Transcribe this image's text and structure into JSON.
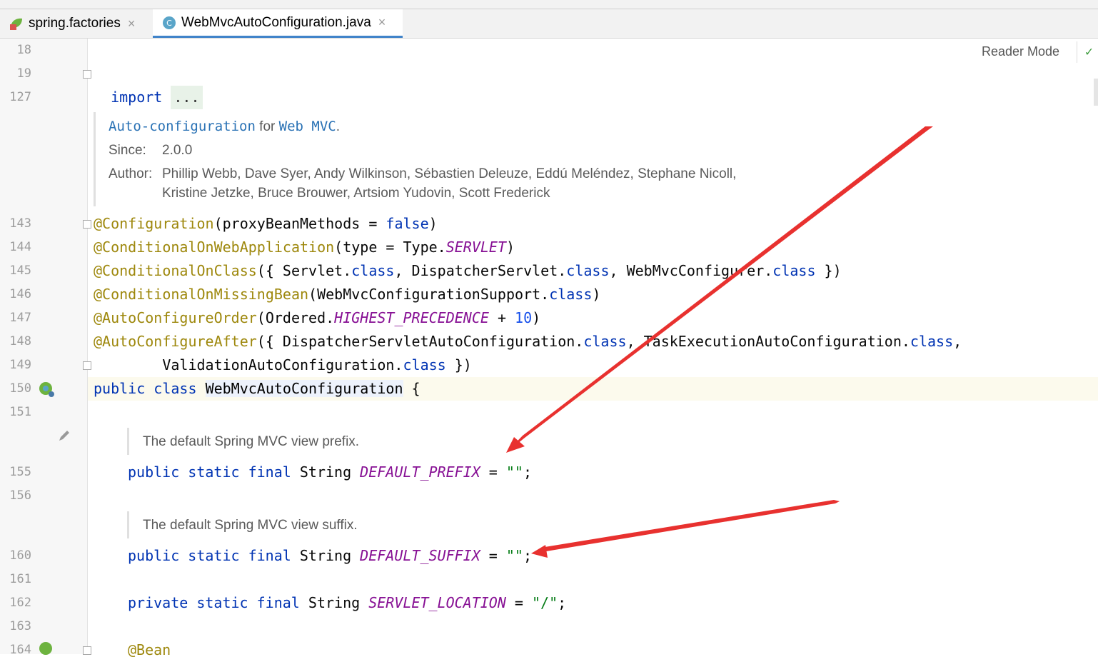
{
  "tabs": [
    {
      "label": "spring.factories",
      "icon": "spring-factories-icon",
      "close": "×"
    },
    {
      "label": "WebMvcAutoConfiguration.java",
      "icon": "java-class-icon",
      "close": "×"
    }
  ],
  "toolbar": {
    "reader_mode": "Reader Mode",
    "check": "✓"
  },
  "line_numbers": [
    "18",
    "19",
    "127",
    "143",
    "144",
    "145",
    "146",
    "147",
    "148",
    "149",
    "150",
    "151",
    "155",
    "156",
    "160",
    "161",
    "162",
    "163",
    "164"
  ],
  "code": {
    "import_kw": "import",
    "import_fold": "...",
    "javadoc": {
      "link1": "Auto-configuration",
      "for": " for ",
      "link2": "Web MVC",
      "period": ".",
      "since_label": "Since:",
      "since_value": "2.0.0",
      "author_label": "Author:",
      "author_line1": "Phillip Webb, Dave Syer, Andy Wilkinson, Sébastien Deleuze, Eddú Meléndez, Stephane Nicoll,",
      "author_line2": "Kristine Jetzke, Bruce Brouwer, Artsiom Yudovin, Scott Frederick"
    },
    "l143": {
      "ann": "@Configuration",
      "a": "(proxyBeanMethods = ",
      "kw": "false",
      "b": ")"
    },
    "l144": {
      "ann": "@ConditionalOnWebApplication",
      "a": "(type = Type.",
      "fld": "SERVLET",
      "b": ")"
    },
    "l145": {
      "ann": "@ConditionalOnClass",
      "a": "({ Servlet.",
      "kw1": "class",
      "b": ", DispatcherServlet.",
      "kw2": "class",
      "c": ", WebMvcConfigurer.",
      "kw3": "class",
      "d": " })"
    },
    "l146": {
      "ann": "@ConditionalOnMissingBean",
      "a": "(WebMvcConfigurationSupport.",
      "kw": "class",
      "b": ")"
    },
    "l147": {
      "ann": "@AutoConfigureOrder",
      "a": "(Ordered.",
      "fld": "HIGHEST_PRECEDENCE",
      "b": " + ",
      "num": "10",
      "c": ")"
    },
    "l148": {
      "ann": "@AutoConfigureAfter",
      "a": "({ DispatcherServletAutoConfiguration.",
      "kw1": "class",
      "b": ", TaskExecutionAutoConfiguration.",
      "kw2": "class",
      "c": ","
    },
    "l149": {
      "a": "        ValidationAutoConfiguration.",
      "kw": "class",
      "b": " })"
    },
    "l150": {
      "kw1": "public",
      "kw2": "class",
      "name": "WebMvcAutoConfiguration",
      "brace": " {"
    },
    "doc_prefix": "The default Spring MVC view prefix.",
    "l155": {
      "kw1": "public",
      "kw2": "static",
      "kw3": "final",
      "type": "String",
      "fld": "DEFAULT_PREFIX",
      "eq": " = ",
      "str": "\"\"",
      "semi": ";"
    },
    "doc_suffix": "The default Spring MVC view suffix.",
    "l160": {
      "kw1": "public",
      "kw2": "static",
      "kw3": "final",
      "type": "String",
      "fld": "DEFAULT_SUFFIX",
      "eq": " = ",
      "str": "\"\"",
      "semi": ";"
    },
    "l162": {
      "kw1": "private",
      "kw2": "static",
      "kw3": "final",
      "type": "String",
      "fld": "SERVLET_LOCATION",
      "eq": " = ",
      "str": "\"/\"",
      "semi": ";"
    },
    "l164": {
      "ann": "@Bean"
    }
  },
  "colors": {
    "keyword": "#0033b3",
    "annotation": "#9e880d",
    "field": "#871094",
    "string": "#067d17",
    "number": "#1750eb",
    "arrow": "#e8312f"
  }
}
